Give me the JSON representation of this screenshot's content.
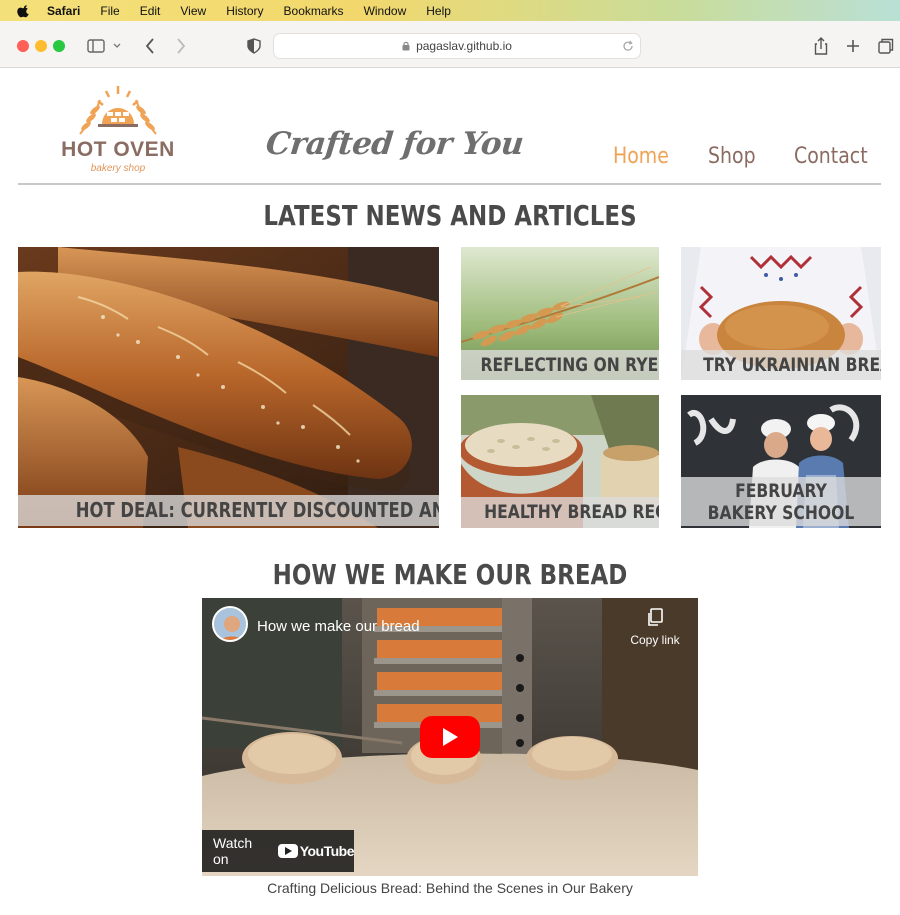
{
  "menubar": {
    "items": [
      "Safari",
      "File",
      "Edit",
      "View",
      "History",
      "Bookmarks",
      "Window",
      "Help"
    ]
  },
  "browser": {
    "url": "pagaslav.github.io"
  },
  "header": {
    "logo_title": "HOT OVEN",
    "logo_subtitle": "bakery shop",
    "tagline": "Crafted for You",
    "nav": [
      "Home",
      "Shop",
      "Contact"
    ],
    "active_nav": "Home"
  },
  "news": {
    "heading": "LATEST NEWS AND ARTICLES",
    "cards": [
      "HOT DEAL: CURRENTLY DISCOUNTED AND POPULAR ITEM",
      "REFLECTING ON RYE",
      "TRY UKRAINIAN BREAD",
      "HEALTHY BREAD RECIPE",
      "FEBRUARY BAKERY SCHOOL"
    ]
  },
  "video_section": {
    "heading": "HOW WE MAKE OUR BREAD",
    "video_title": "How we make our bread",
    "copy_link": "Copy link",
    "watch_on": "Watch on",
    "platform": "YouTube",
    "caption": "Crafting Delicious Bread: Behind the Scenes in Our Bakery"
  },
  "colors": {
    "accent": "#f0a255",
    "nav_text": "#8b6c62",
    "heading": "#4a4a4a"
  }
}
